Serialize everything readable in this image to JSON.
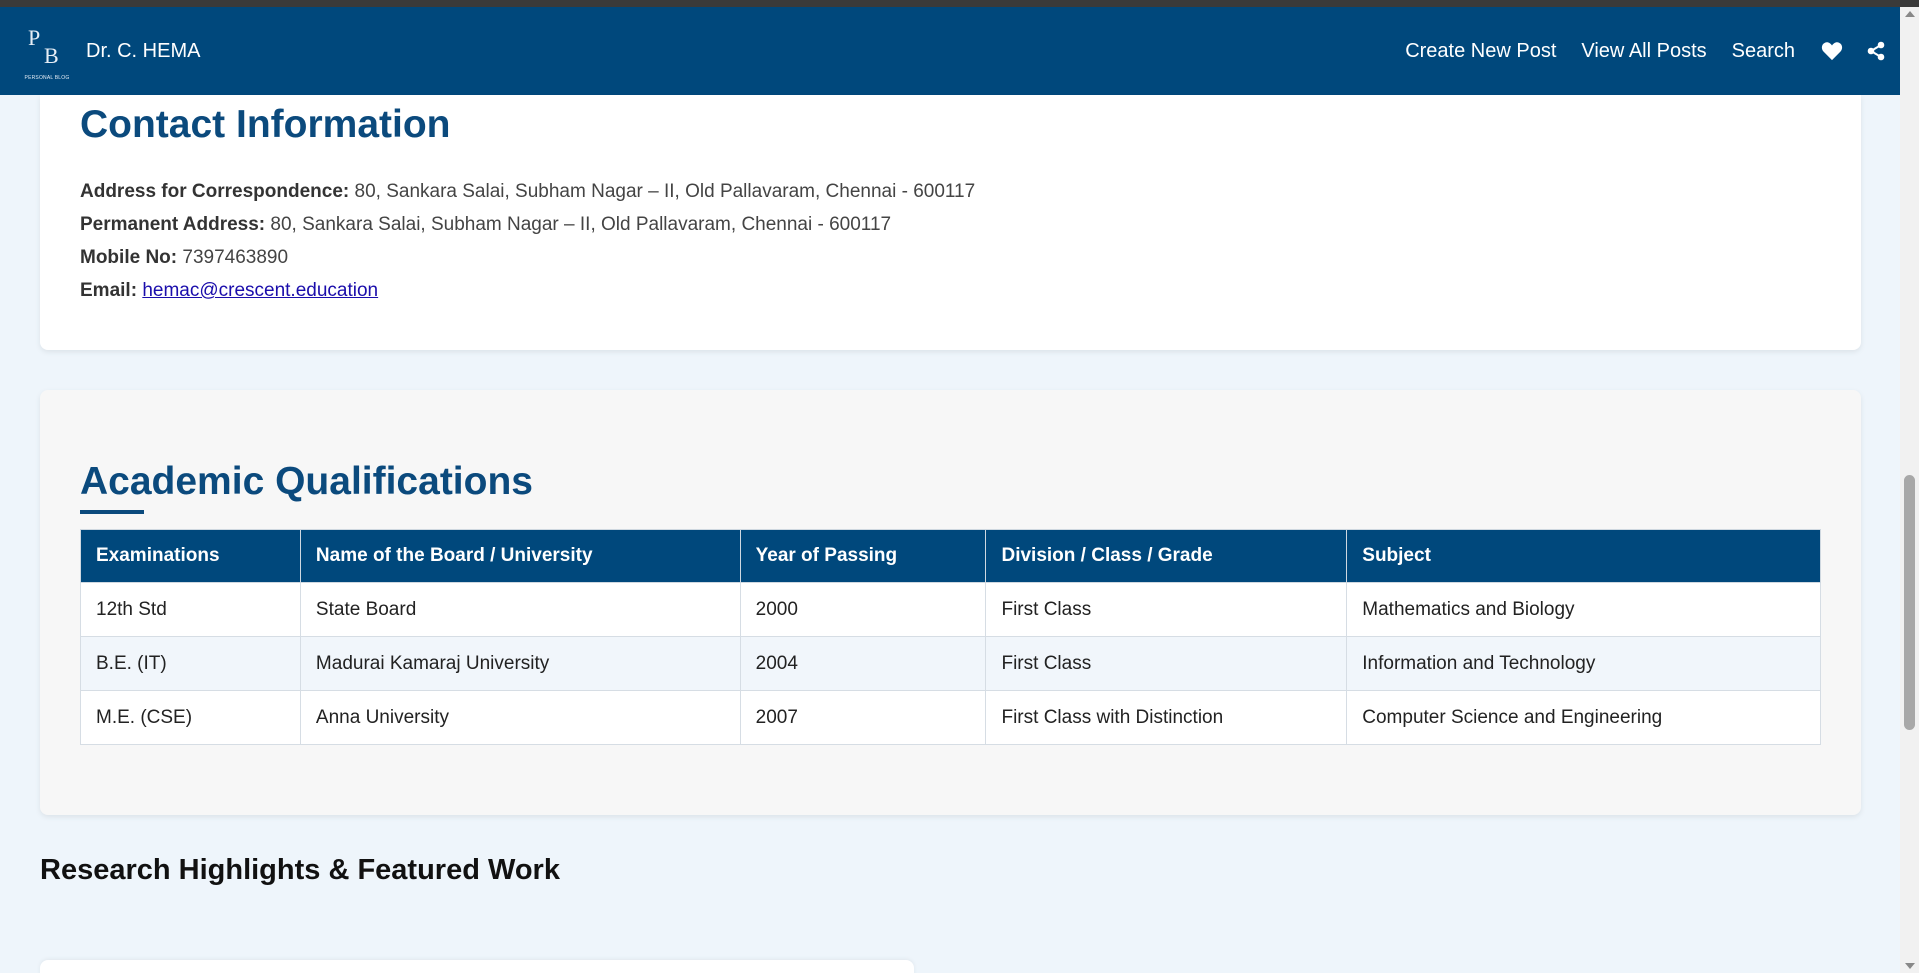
{
  "header": {
    "logo_letters": {
      "p": "P",
      "b": "B",
      "tag": "PERSONAL BLOG"
    },
    "brand": "Dr. C. HEMA",
    "nav": [
      {
        "label": "Create New Post"
      },
      {
        "label": "View All Posts"
      },
      {
        "label": "Search"
      }
    ],
    "icons": [
      "heart-icon",
      "share-icon"
    ],
    "bg_color": "#00487c"
  },
  "contact": {
    "title": "Contact Information",
    "address_label": "Address for Correspondence:",
    "address_value": "80, Sankara Salai, Subham Nagar – II, Old Pallavaram, Chennai - 600117",
    "permanent_label": "Permanent Address:",
    "permanent_value": "80, Sankara Salai, Subham Nagar – II, Old Pallavaram, Chennai - 600117",
    "mobile_label": "Mobile No:",
    "mobile_value": "7397463890",
    "email_label": "Email:",
    "email_value": "hemac@crescent.education"
  },
  "academic": {
    "title": "Academic Qualifications",
    "headers": [
      "Examinations",
      "Name of the Board / University",
      "Year of Passing",
      "Division / Class / Grade",
      "Subject"
    ],
    "rows": [
      [
        "12th Std",
        "State Board",
        "2000",
        "First Class",
        "Mathematics and Biology"
      ],
      [
        "B.E. (IT)",
        "Madurai Kamaraj University",
        "2004",
        "First Class",
        "Information and Technology"
      ],
      [
        "M.E. (CSE)",
        "Anna University",
        "2007",
        "First Class with Distinction",
        "Computer Science and Engineering"
      ]
    ]
  },
  "research": {
    "title": "Research Highlights & Featured Work"
  }
}
